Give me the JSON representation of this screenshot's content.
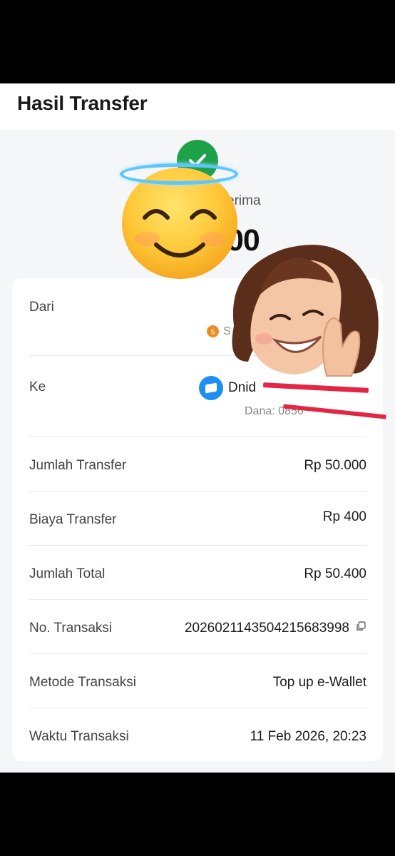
{
  "header": {
    "title": "Hasil Transfer"
  },
  "status": {
    "text_partial": "erima",
    "amount_partial": "00"
  },
  "details": {
    "from": {
      "label": "Dari",
      "bank_initial": "S",
      "sub_partial": "S"
    },
    "to": {
      "label": "Ke",
      "name_partial": "Dnid",
      "sub_partial": "Dana: 0856"
    },
    "rows": [
      {
        "label": "Jumlah Transfer",
        "value": "Rp 50.000"
      },
      {
        "label": "Biaya Transfer",
        "value": "Rp 400"
      },
      {
        "label": "Jumlah Total",
        "value": "Rp 50.400"
      },
      {
        "label": "No. Transaksi",
        "value": "2026021143504215683998"
      },
      {
        "label": "Metode Transaksi",
        "value": "Top up e-Wallet"
      },
      {
        "label": "Waktu Transaksi",
        "value": "11 Feb 2026, 20:23"
      }
    ]
  },
  "icons": {
    "success": "check-circle-icon",
    "bank": "bank-logo-icon",
    "wallet": "dana-wallet-icon",
    "copy": "copy-icon"
  },
  "colors": {
    "success": "#1fa14a",
    "wallet": "#1e8ff0",
    "redaction": "#e32646"
  }
}
